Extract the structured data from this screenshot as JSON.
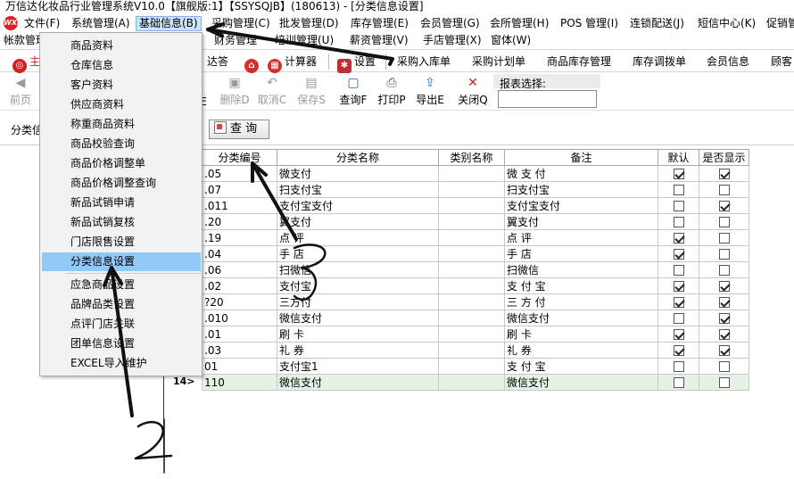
{
  "window": {
    "title": "万信达化妆品行业管理系统V10.0【旗舰版:1】【SSYSQJB】(180613) - [分类信息设置]"
  },
  "menubar": {
    "logo_text": "WXD",
    "items": [
      {
        "label": "文件(F)"
      },
      {
        "label": "系统管理(A)"
      },
      {
        "label": "基础信息(B)"
      },
      {
        "label": "采购管理(C)"
      },
      {
        "label": "批发管理(D)"
      },
      {
        "label": "库存管理(E)"
      },
      {
        "label": "会员管理(G)"
      },
      {
        "label": "会所管理(H)"
      },
      {
        "label": "POS 管理(I)"
      },
      {
        "label": "连锁配送(J)"
      },
      {
        "label": "短信中心(K)"
      },
      {
        "label": "促销管"
      }
    ]
  },
  "menubar2": {
    "items": [
      {
        "label": "帐款管理"
      },
      {
        "label": "财务管理"
      },
      {
        "label": "培训管理(U)"
      },
      {
        "label": "薪资管理(V)"
      },
      {
        "label": "手店管理(X)"
      },
      {
        "label": "窗体(W)"
      }
    ]
  },
  "quickbar": {
    "items": [
      {
        "label": "主"
      },
      {
        "label": "达答"
      },
      {
        "label": "计算器"
      },
      {
        "label": "设置"
      },
      {
        "label": "采购入库单"
      },
      {
        "label": "采购计划单"
      },
      {
        "label": "商品库存管理"
      },
      {
        "label": "库存调拨单"
      },
      {
        "label": "会员信息"
      },
      {
        "label": "顾客"
      }
    ]
  },
  "toolbar": {
    "prev_page": "前页",
    "delete": "删除D",
    "cancel": "取消C",
    "save": "保存S",
    "query": "查询F",
    "print": "打印P",
    "export": "导出E",
    "close": "关闭Q",
    "report_label": "报表选择:",
    "report_value": "",
    "partial_label": "E"
  },
  "filter": {
    "label": "分类信",
    "query_button": "查  询"
  },
  "grid": {
    "columns": [
      "分类编号",
      "分类名称",
      "类别名称",
      "备注",
      "默认",
      "是否显示"
    ],
    "rows": [
      {
        "code": ".05",
        "name": "微支付",
        "category": "",
        "note": "微 支 付",
        "default": true,
        "show": true
      },
      {
        "code": ".07",
        "name": "扫支付宝",
        "category": "",
        "note": "扫支付宝",
        "default": false,
        "show": false
      },
      {
        "code": ".011",
        "name": "支付宝支付",
        "category": "",
        "note": "支付宝支付",
        "default": false,
        "show": true
      },
      {
        "code": ".20",
        "name": "翼支付",
        "category": "",
        "note": "翼支付",
        "default": false,
        "show": false
      },
      {
        "code": ".19",
        "name": "点  评",
        "category": "",
        "note": "点     评",
        "default": true,
        "show": false
      },
      {
        "code": ".04",
        "name": "手  店",
        "category": "",
        "note": "手     店",
        "default": true,
        "show": false
      },
      {
        "code": ".06",
        "name": "扫微信",
        "category": "",
        "note": "扫微信",
        "default": false,
        "show": false
      },
      {
        "code": ".02",
        "name": "支付宝",
        "category": "",
        "note": "支 付 宝",
        "default": true,
        "show": true
      },
      {
        "code": "?20",
        "name": "三方付",
        "category": "",
        "note": "三 方 付",
        "default": true,
        "show": true
      },
      {
        "code": ".010",
        "name": "微信支付",
        "category": "",
        "note": "微信支付",
        "default": false,
        "show": true
      },
      {
        "code": ".01",
        "name": "刷  卡",
        "category": "",
        "note": "刷     卡",
        "default": true,
        "show": true
      },
      {
        "code": ".03",
        "name": "礼  券",
        "category": "",
        "note": "礼     券",
        "default": true,
        "show": true
      },
      {
        "code": "01",
        "name": "支付宝1",
        "category": "",
        "note": "支 付 宝",
        "default": false,
        "show": false
      },
      {
        "code": "110",
        "name": "微信支付",
        "category": "",
        "note": "微信支付",
        "default": false,
        "show": false
      }
    ],
    "current_row_label": "14>"
  },
  "dropdown": {
    "items": [
      {
        "label": "商品资料"
      },
      {
        "label": "仓库信息"
      },
      {
        "label": "客户资料"
      },
      {
        "label": "供应商资料"
      },
      {
        "label": "称重商品资料"
      },
      {
        "label": "商品校验查询"
      },
      {
        "label": "商品价格调整单"
      },
      {
        "label": "商品价格调整查询"
      },
      {
        "label": "新品试销申请"
      },
      {
        "label": "新品试销复核"
      },
      {
        "label": "门店限售设置"
      },
      {
        "label": "分类信息设置"
      },
      {
        "label": "应急商品设置"
      },
      {
        "label": "品牌品类设置"
      },
      {
        "label": "点评门店关联"
      },
      {
        "label": "团单信息设置"
      },
      {
        "label": "EXCEL导入维护"
      }
    ],
    "selected": "分类信息设置"
  },
  "annotations": {
    "mark_2": "2",
    "mark_3": "3"
  },
  "colors": {
    "menu_active_bg": "#cce4f7",
    "dropdown_selected": "#91c9f7",
    "current_row_bg": "#e6f2e6"
  }
}
